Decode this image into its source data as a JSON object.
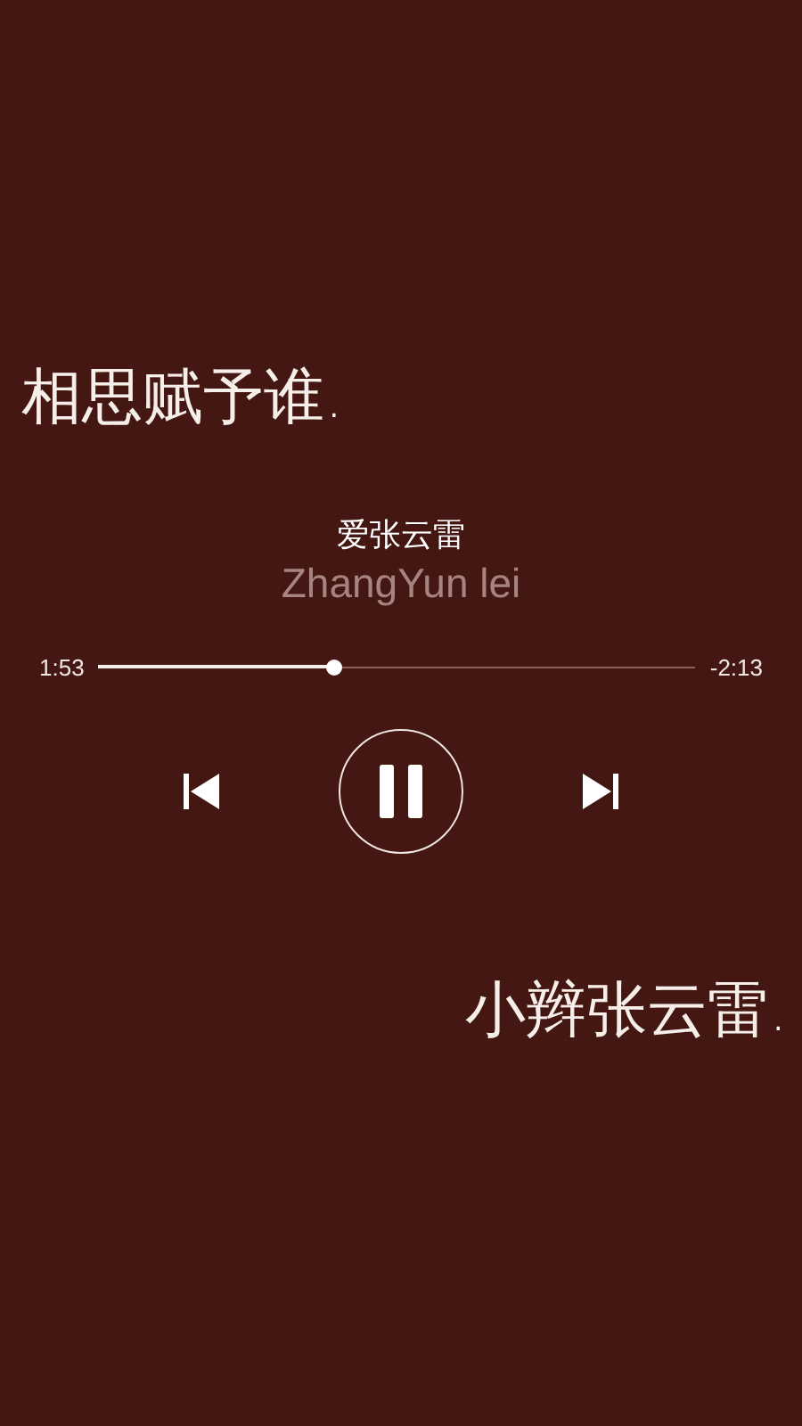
{
  "lyric_top": "相思赋予谁.",
  "track": {
    "title": "爱张云雷",
    "artist": "ZhangYun lei"
  },
  "progress": {
    "elapsed": "1:53",
    "remaining": "-2:13",
    "level": 0.395
  },
  "playback": {
    "playing": true
  },
  "lyric_bottom": "小辫张云雷."
}
